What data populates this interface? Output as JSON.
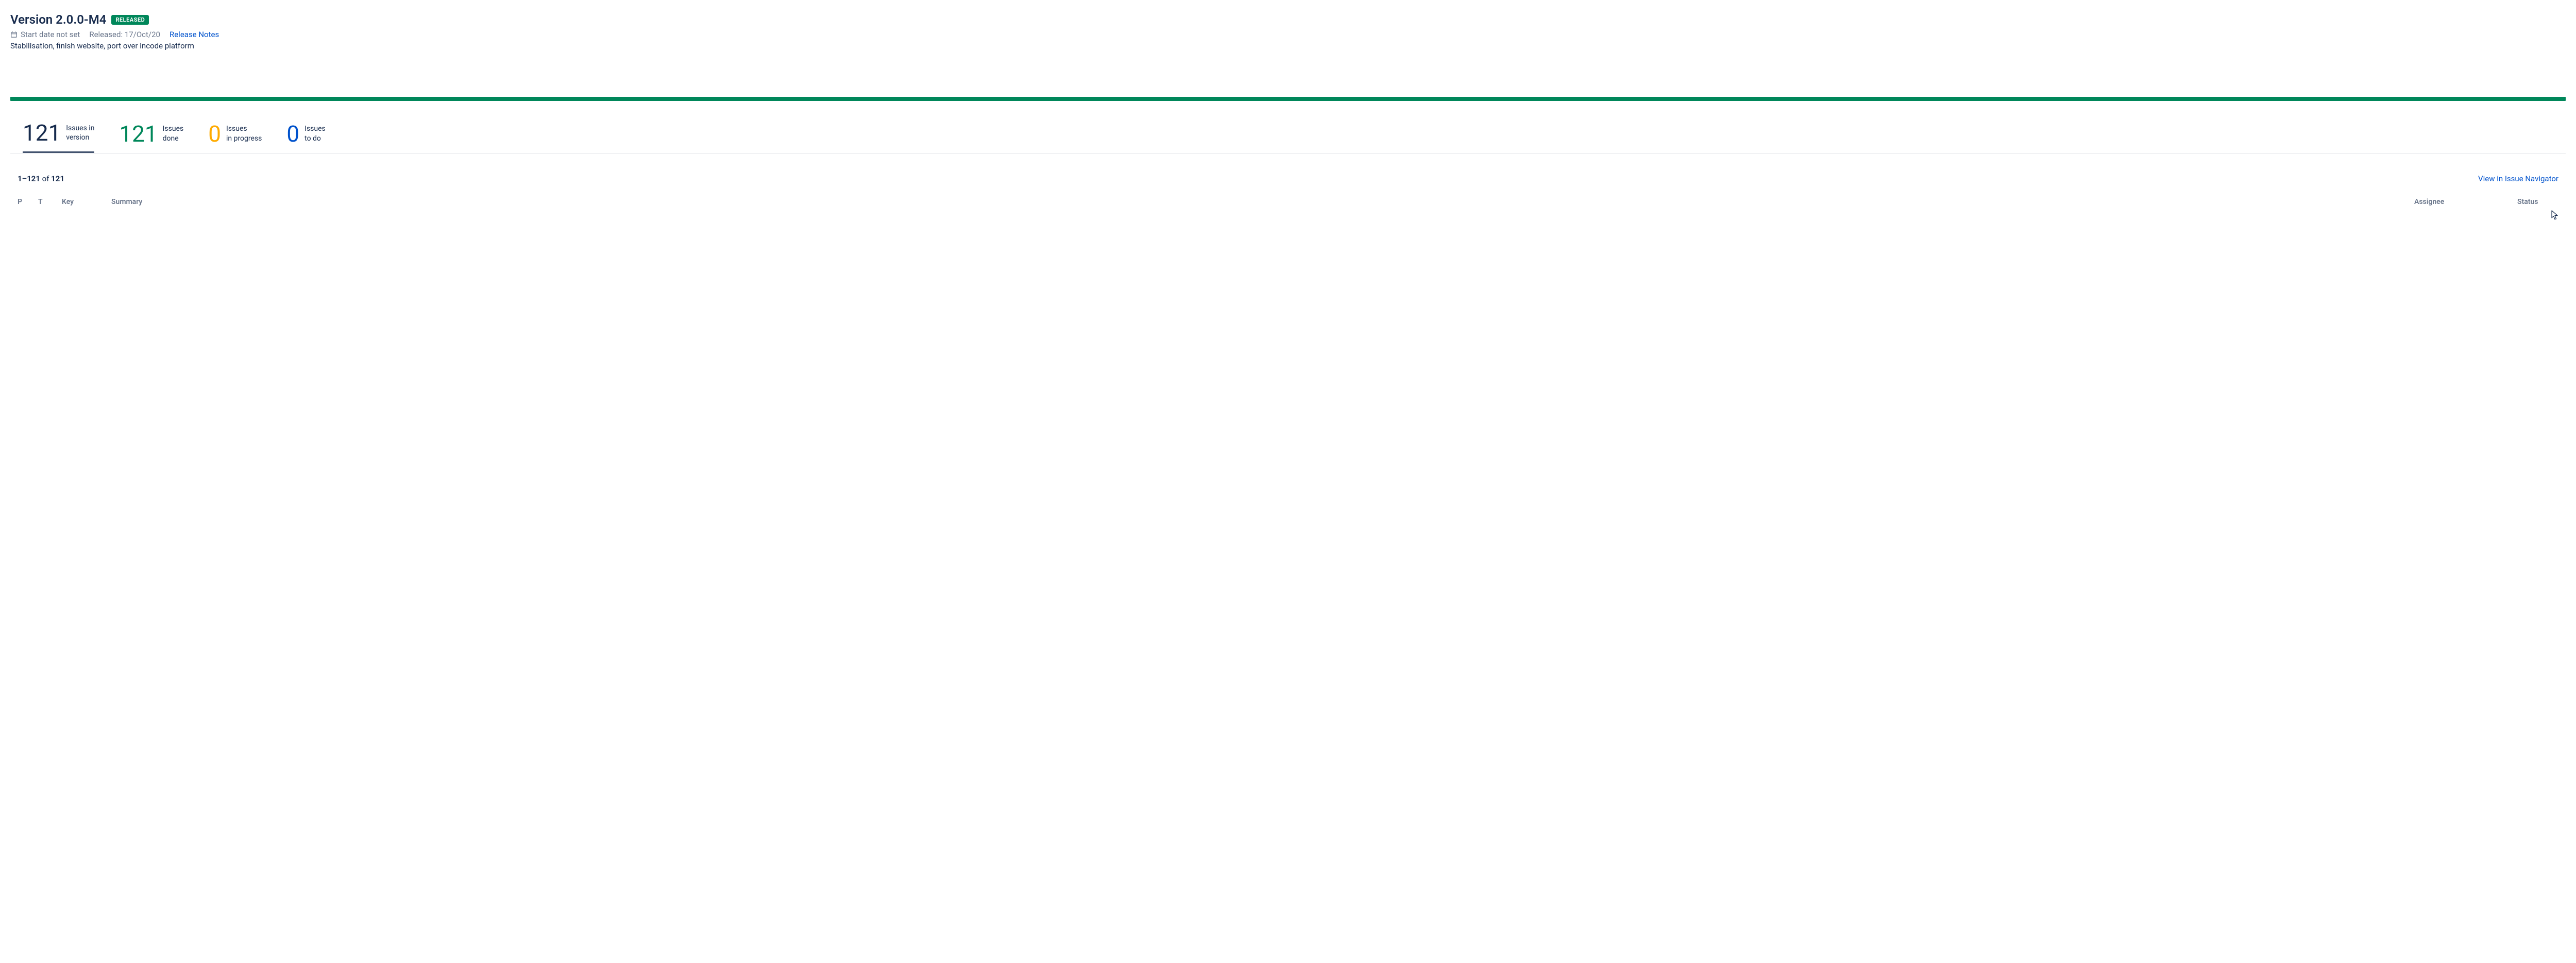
{
  "header": {
    "title": "Version 2.0.0-M4",
    "badge": "RELEASED",
    "start_date_text": "Start date not set",
    "released_text": "Released: 17/Oct/20",
    "release_notes_link": "Release Notes",
    "description": "Stabilisation, finish website, port over incode platform"
  },
  "progress": {
    "percent_complete": 100,
    "color": "#00875a"
  },
  "stats": [
    {
      "id": "in-version",
      "number": "121",
      "line1": "Issues in",
      "line2": "version",
      "color": "default",
      "active": true
    },
    {
      "id": "done",
      "number": "121",
      "line1": "Issues",
      "line2": "done",
      "color": "green",
      "active": false
    },
    {
      "id": "in-progress",
      "number": "0",
      "line1": "Issues",
      "line2": "in progress",
      "color": "yellow",
      "active": false
    },
    {
      "id": "to-do",
      "number": "0",
      "line1": "Issues",
      "line2": "to do",
      "color": "blue",
      "active": false
    }
  ],
  "list": {
    "pagination_from": "1",
    "pagination_to": "121",
    "pagination_of_word": "of",
    "pagination_total": "121",
    "navigator_link": "View in Issue Navigator",
    "columns": {
      "p": "P",
      "t": "T",
      "key": "Key",
      "summary": "Summary",
      "assignee": "Assignee",
      "status": "Status"
    }
  }
}
